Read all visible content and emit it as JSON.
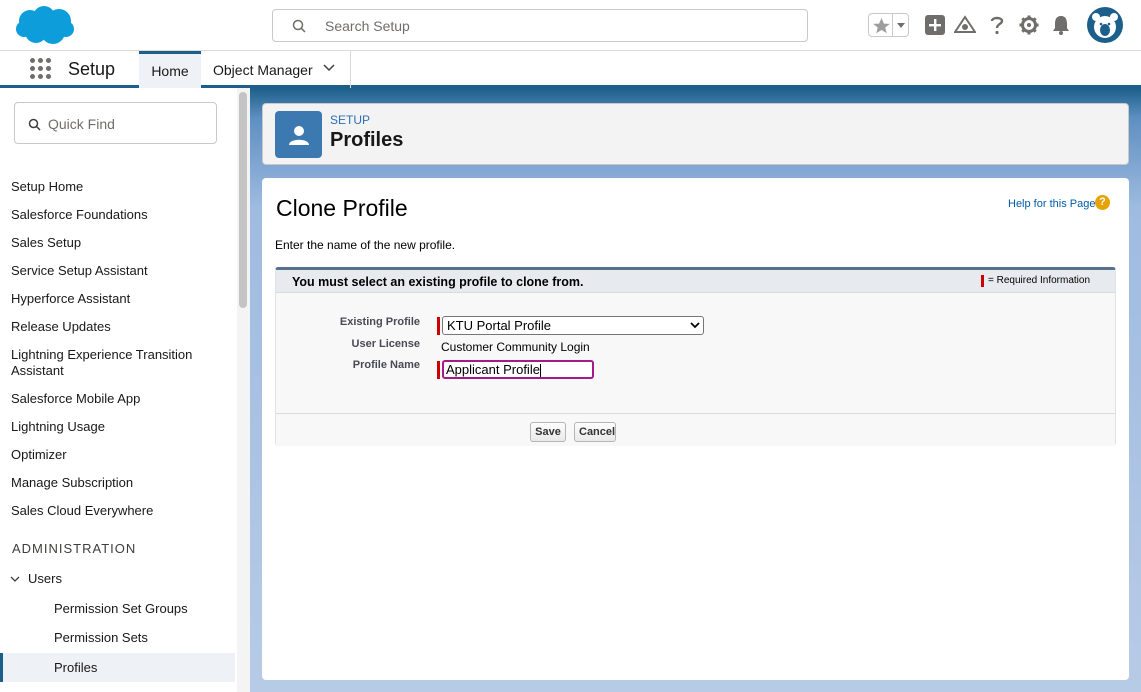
{
  "header": {
    "search_placeholder": "Search Setup",
    "icons": [
      "salesforce-cloud-logo",
      "search-icon",
      "star-icon",
      "add-icon",
      "trailhead-icon",
      "help-icon",
      "gear-icon",
      "bell-icon",
      "avatar"
    ]
  },
  "context_bar": {
    "app_name": "Setup",
    "tabs": [
      {
        "label": "Home",
        "active": true
      },
      {
        "label": "Object Manager",
        "active": false
      }
    ]
  },
  "sidebar": {
    "quickfind_placeholder": "Quick Find",
    "items": [
      "Setup Home",
      "Salesforce Foundations",
      "Sales Setup",
      "Service Setup Assistant",
      "Hyperforce Assistant",
      "Release Updates",
      "Lightning Experience Transition Assistant",
      "Salesforce Mobile App",
      "Lightning Usage",
      "Optimizer",
      "Manage Subscription",
      "Sales Cloud Everywhere"
    ],
    "section_header": "ADMINISTRATION",
    "users_group": {
      "label": "Users",
      "children": [
        "Permission Set Groups",
        "Permission Sets",
        "Profiles"
      ],
      "active_child": "Profiles"
    }
  },
  "page_header": {
    "eyebrow": "SETUP",
    "title": "Profiles"
  },
  "form": {
    "title": "Clone Profile",
    "help_link": "Help for this Page",
    "description": "Enter the name of the new profile.",
    "block_title": "You must select an existing profile to clone from.",
    "required_legend": "= Required Information",
    "fields": {
      "existing_profile_label": "Existing Profile",
      "existing_profile_value": "KTU Portal Profile",
      "user_license_label": "User License",
      "user_license_value": "Customer Community Login",
      "profile_name_label": "Profile Name",
      "profile_name_value": "Applicant Profile"
    },
    "buttons": {
      "save": "Save",
      "cancel": "Cancel"
    }
  },
  "colors": {
    "brand_blue": "#1b5f8a",
    "cloud_blue": "#0d9dda",
    "required_red": "#cc0000",
    "link_blue": "#015ba7"
  }
}
